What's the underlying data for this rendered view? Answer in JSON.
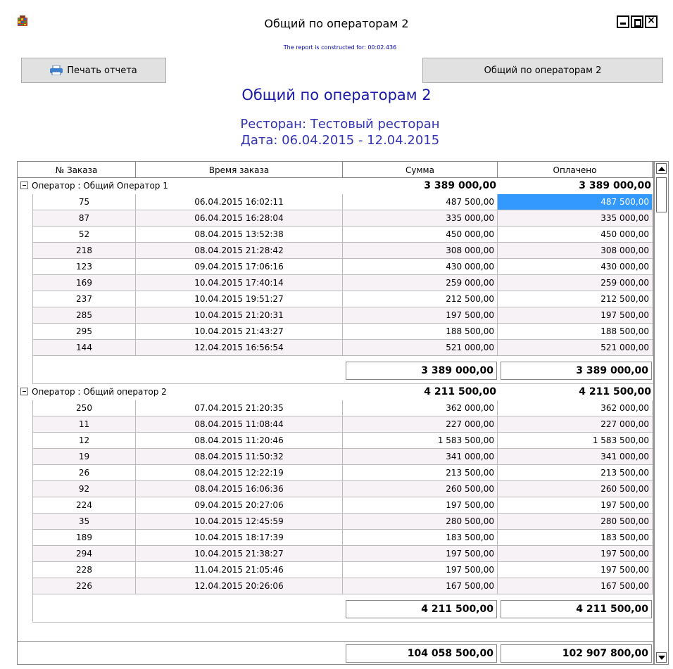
{
  "window": {
    "title": "Общий по операторам 2",
    "icon": "app-grid-icon"
  },
  "constructed_for": "The report is constructed for: 00:02.436",
  "toolbar": {
    "print_label": "Печать отчета",
    "report_label": "Общий по операторам 2"
  },
  "report": {
    "title": "Общий по операторам 2",
    "restaurant": "Ресторан: Тестовый ресторан",
    "date": "Дата: 06.04.2015 - 12.04.2015"
  },
  "table": {
    "headers": [
      "№ Заказа",
      "Время заказа",
      "Сумма",
      "Оплачено"
    ],
    "groups": [
      {
        "label": "Оператор : Общий Оператор 1",
        "sum": "3 389 000,00",
        "paid": "3 389 000,00",
        "rows": [
          {
            "id": "75",
            "time": "06.04.2015 16:02:11",
            "sum": "487 500,00",
            "paid": "487 500,00"
          },
          {
            "id": "87",
            "time": "06.04.2015 16:28:04",
            "sum": "335 000,00",
            "paid": "335 000,00"
          },
          {
            "id": "52",
            "time": "08.04.2015 13:52:38",
            "sum": "450 000,00",
            "paid": "450 000,00"
          },
          {
            "id": "218",
            "time": "08.04.2015 21:28:42",
            "sum": "308 000,00",
            "paid": "308 000,00"
          },
          {
            "id": "123",
            "time": "09.04.2015 17:06:16",
            "sum": "430 000,00",
            "paid": "430 000,00"
          },
          {
            "id": "169",
            "time": "10.04.2015 17:40:14",
            "sum": "259 000,00",
            "paid": "259 000,00"
          },
          {
            "id": "237",
            "time": "10.04.2015 19:51:27",
            "sum": "212 500,00",
            "paid": "212 500,00"
          },
          {
            "id": "285",
            "time": "10.04.2015 21:20:31",
            "sum": "197 500,00",
            "paid": "197 500,00"
          },
          {
            "id": "295",
            "time": "10.04.2015 21:43:27",
            "sum": "188 500,00",
            "paid": "188 500,00"
          },
          {
            "id": "144",
            "time": "12.04.2015 16:56:54",
            "sum": "521 000,00",
            "paid": "521 000,00"
          }
        ],
        "subtotal_sum": "3 389 000,00",
        "subtotal_paid": "3 389 000,00"
      },
      {
        "label": "Оператор : Общий оператор 2",
        "sum": "4 211 500,00",
        "paid": "4 211 500,00",
        "rows": [
          {
            "id": "250",
            "time": "07.04.2015 21:20:35",
            "sum": "362 000,00",
            "paid": "362 000,00"
          },
          {
            "id": "11",
            "time": "08.04.2015 11:08:44",
            "sum": "227 000,00",
            "paid": "227 000,00"
          },
          {
            "id": "12",
            "time": "08.04.2015 11:20:46",
            "sum": "1 583 500,00",
            "paid": "1 583 500,00"
          },
          {
            "id": "19",
            "time": "08.04.2015 11:50:32",
            "sum": "341 000,00",
            "paid": "341 000,00"
          },
          {
            "id": "26",
            "time": "08.04.2015 12:22:19",
            "sum": "213 500,00",
            "paid": "213 500,00"
          },
          {
            "id": "92",
            "time": "08.04.2015 16:06:36",
            "sum": "260 500,00",
            "paid": "260 500,00"
          },
          {
            "id": "224",
            "time": "09.04.2015 20:27:06",
            "sum": "197 500,00",
            "paid": "197 500,00"
          },
          {
            "id": "35",
            "time": "10.04.2015 12:45:59",
            "sum": "280 500,00",
            "paid": "280 500,00"
          },
          {
            "id": "189",
            "time": "10.04.2015 18:17:39",
            "sum": "183 500,00",
            "paid": "183 500,00"
          },
          {
            "id": "294",
            "time": "10.04.2015 21:38:27",
            "sum": "197 500,00",
            "paid": "197 500,00"
          },
          {
            "id": "228",
            "time": "11.04.2015 21:05:46",
            "sum": "197 500,00",
            "paid": "197 500,00"
          },
          {
            "id": "226",
            "time": "12.04.2015 20:26:06",
            "sum": "167 500,00",
            "paid": "167 500,00"
          }
        ],
        "subtotal_sum": "4 211 500,00",
        "subtotal_paid": "4 211 500,00"
      }
    ],
    "grand_sum": "104 058 500,00",
    "grand_paid": "102 907 800,00"
  },
  "colors": {
    "title_blue": "#1a1aa8",
    "selection": "#3399ff",
    "alt_row": "#f7f2f6"
  }
}
